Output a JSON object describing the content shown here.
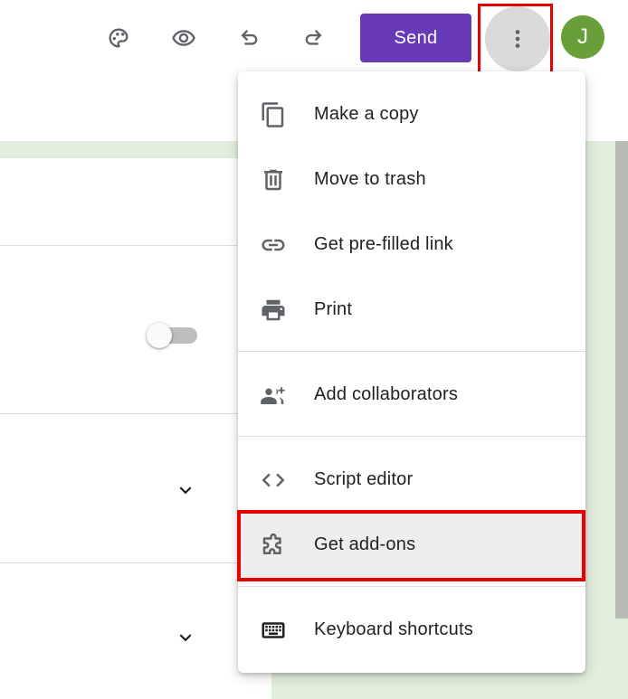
{
  "toolbar": {
    "icons": {
      "palette": "palette-icon",
      "preview": "eye-icon",
      "undo": "undo-icon",
      "redo": "redo-icon",
      "more": "more-vert-icon"
    },
    "send_label": "Send",
    "avatar_initial": "J"
  },
  "menu": {
    "items": [
      {
        "label": "Make a copy",
        "icon": "copy-icon"
      },
      {
        "label": "Move to trash",
        "icon": "trash-icon"
      },
      {
        "label": "Get pre-filled link",
        "icon": "link-icon"
      },
      {
        "label": "Print",
        "icon": "print-icon"
      },
      {
        "label": "Add collaborators",
        "icon": "add-people-icon"
      },
      {
        "label": "Script editor",
        "icon": "code-icon"
      },
      {
        "label": "Get add-ons",
        "icon": "puzzle-icon"
      },
      {
        "label": "Keyboard shortcuts",
        "icon": "keyboard-icon"
      }
    ]
  },
  "settings": {
    "toggle_on": false
  },
  "colors": {
    "accent": "#673ab7",
    "avatar": "#689f38",
    "icon": "#5f6368",
    "highlight": "#e60000",
    "page_bg": "#e2eedc"
  }
}
